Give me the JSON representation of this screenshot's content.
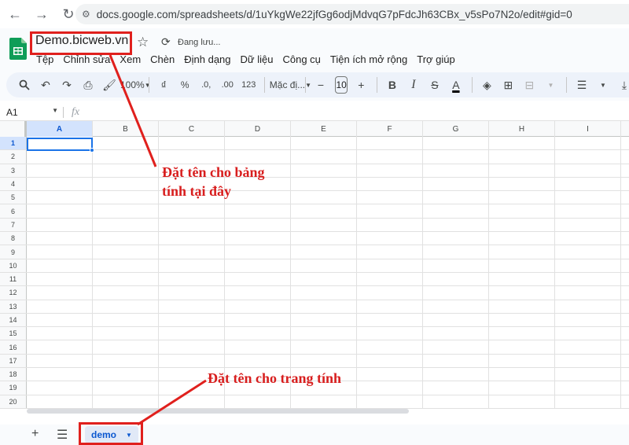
{
  "browser": {
    "url": "docs.google.com/spreadsheets/d/1uYkgWe22jfGg6odjMdvqG7pFdcJh63CBx_v5sPo7N2o/edit#gid=0"
  },
  "app": {
    "title": "Demo.bicweb.vn",
    "status": "Đang lưu...",
    "menu": [
      "Tệp",
      "Chỉnh sửa",
      "Xem",
      "Chèn",
      "Định dạng",
      "Dữ liệu",
      "Công cụ",
      "Tiện ích mở rộng",
      "Trợ giúp"
    ]
  },
  "toolbar": {
    "zoom": "100%",
    "currency": "₫",
    "percent": "%",
    "dec_decrease": ".0,",
    "dec_increase": ".00",
    "number_format": "123",
    "font": "Mặc đị...",
    "font_size": "10",
    "minus": "−",
    "plus": "+"
  },
  "formula": {
    "cell_ref": "A1",
    "fx": "fx"
  },
  "grid": {
    "columns": [
      "A",
      "B",
      "C",
      "D",
      "E",
      "F",
      "G",
      "H",
      "I"
    ],
    "rows": [
      "1",
      "2",
      "3",
      "4",
      "5",
      "6",
      "7",
      "8",
      "9",
      "10",
      "11",
      "12",
      "13",
      "14",
      "15",
      "16",
      "17",
      "18",
      "19",
      "20"
    ],
    "selected_cell": "A1"
  },
  "sheets": {
    "tabs": [
      "demo"
    ]
  },
  "annotations": {
    "title_note_line1": "Đặt tên cho bảng",
    "title_note_line2": "tính tại đây",
    "sheet_note": "Đặt tên cho trang tính",
    "color": "#e0201d"
  }
}
